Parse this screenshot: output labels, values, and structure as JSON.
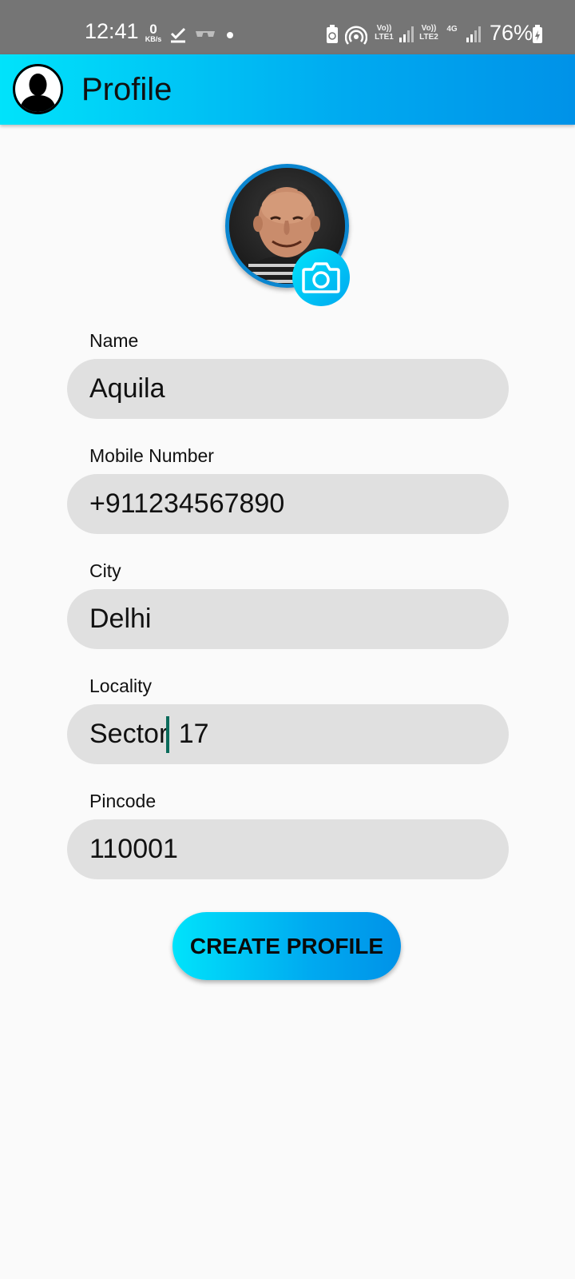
{
  "status_bar": {
    "time": "12:41",
    "kbs_value": "0",
    "kbs_unit": "KB/s",
    "sim1": "Vo))\nLTE1",
    "sim2": "Vo))\nLTE2",
    "network_type": "4G",
    "battery": "76%",
    "icons": [
      "check-icon",
      "incognito-icon",
      "dot-icon",
      "battery-saver-icon",
      "hotspot-icon",
      "signal-icon",
      "battery-icon"
    ]
  },
  "app_bar": {
    "title": "Profile",
    "icon": "user-avatar-icon"
  },
  "profile_photo": {
    "camera_icon": "camera-icon"
  },
  "form": {
    "name_label": "Name",
    "name_value": "Aquila",
    "mobile_label": "Mobile Number",
    "mobile_value": "+911234567890",
    "city_label": "City",
    "city_value": "Delhi",
    "locality_label": "Locality",
    "locality_before_caret": "Sector",
    "locality_after_caret": " 17",
    "pincode_label": "Pincode",
    "pincode_value": "110001"
  },
  "create_button": "CREATE PROFILE",
  "colors": {
    "accent_start": "#00e3fb",
    "accent_end": "#0092e8",
    "field_bg": "#e0e0e0",
    "photo_border": "#0a86d0"
  }
}
